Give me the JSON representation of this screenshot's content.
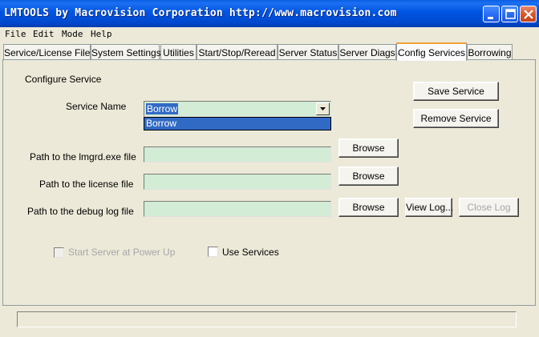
{
  "window": {
    "title": "LMTOOLS by Macrovision Corporation http://www.macrovision.com"
  },
  "menu": [
    "File",
    "Edit",
    "Mode",
    "Help"
  ],
  "tabs": [
    "Service/License File",
    "System Settings",
    "Utilities",
    "Start/Stop/Reread",
    "Server Status",
    "Server Diags",
    "Config Services",
    "Borrowing"
  ],
  "active_tab": "Config Services",
  "config": {
    "section_title": "Configure Service",
    "service_name_label": "Service Name",
    "service_name_value": "Borrow",
    "dropdown_option": "Borrow",
    "lmgrd_label": "Path to the lmgrd.exe file",
    "license_label": "Path to the license file",
    "debug_label": "Path to the debug log file",
    "lmgrd_value": "",
    "license_value": "",
    "debug_value": "",
    "browse_label": "Browse",
    "save_service": "Save Service",
    "remove_service": "Remove Service",
    "view_log": "View Log...",
    "close_log": "Close Log",
    "start_at_powerup": "Start Server at Power Up",
    "use_services": "Use Services"
  },
  "colors": {
    "field_bg": "#d3ecd5",
    "selection": "#316ac5",
    "titlebar": "#0054e3",
    "active_tab_accent": "#f1a137"
  }
}
